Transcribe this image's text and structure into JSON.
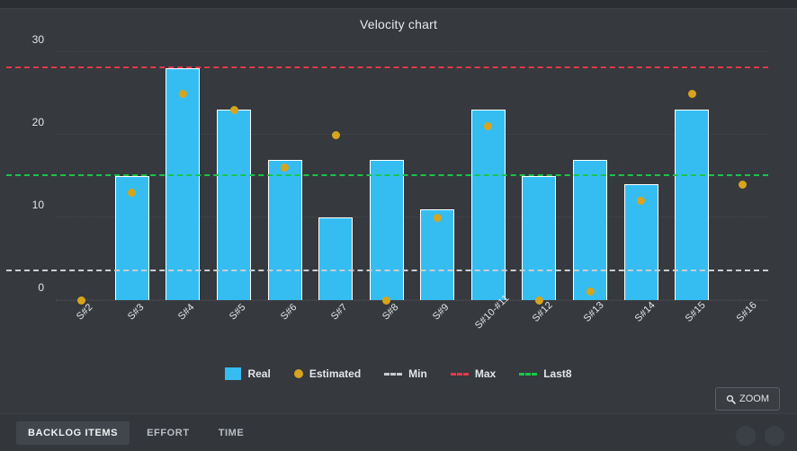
{
  "chart": {
    "title": "Velocity chart"
  },
  "legend": {
    "items": [
      {
        "label": "Real",
        "type": "box",
        "color": "#35bdf2",
        "icon": "square-swatch-icon"
      },
      {
        "label": "Estimated",
        "type": "dot",
        "color": "#d6a41e",
        "icon": "circle-swatch-icon"
      },
      {
        "label": "Min",
        "type": "dash",
        "color": "#c9ccd0",
        "icon": "dash-swatch-icon"
      },
      {
        "label": "Max",
        "type": "dash",
        "color": "#e2394a",
        "icon": "dash-swatch-icon"
      },
      {
        "label": "Last8",
        "type": "dash",
        "color": "#18c64a",
        "icon": "dash-swatch-icon"
      }
    ]
  },
  "zoom_button": {
    "label": "ZOOM",
    "icon": "search-icon"
  },
  "tabs": [
    {
      "label": "BACKLOG ITEMS",
      "active": true
    },
    {
      "label": "EFFORT",
      "active": false
    },
    {
      "label": "TIME",
      "active": false
    }
  ],
  "chart_data": {
    "type": "bar",
    "title": "Velocity chart",
    "xlabel": "",
    "ylabel": "",
    "ylim": [
      0,
      30
    ],
    "yticks": [
      0,
      10,
      20,
      30
    ],
    "grid": true,
    "legend_position": "bottom",
    "categories": [
      "S#2",
      "S#3",
      "S#4",
      "S#5",
      "S#6",
      "S#7",
      "S#8",
      "S#9",
      "S#10-#11",
      "S#12",
      "S#13",
      "S#14",
      "S#15",
      "S#16"
    ],
    "series": [
      {
        "name": "Real",
        "type": "bar",
        "color": "#35bdf2",
        "values": [
          0,
          15,
          28,
          23,
          17,
          10,
          17,
          11,
          23,
          15,
          17,
          14,
          23,
          0
        ]
      },
      {
        "name": "Estimated",
        "type": "scatter",
        "color": "#d6a41e",
        "values": [
          0,
          13,
          25,
          23,
          16,
          20,
          0,
          10,
          21,
          0,
          1,
          12,
          25,
          14
        ]
      }
    ],
    "reference_lines": [
      {
        "name": "Min",
        "value": 3.5,
        "color": "#c9ccd0",
        "style": "dashed"
      },
      {
        "name": "Max",
        "value": 28,
        "color": "#e2394a",
        "style": "dashed"
      },
      {
        "name": "Last8",
        "value": 15,
        "color": "#18c64a",
        "style": "dashed"
      }
    ]
  }
}
